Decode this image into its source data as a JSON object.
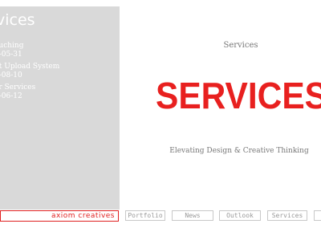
{
  "sidebar": {
    "title": "vices",
    "news": [
      {
        "title": "ouching",
        "date": "5-05-31"
      },
      {
        "title": "nt Upload System",
        "date": "5-08-10"
      },
      {
        "title": "er Services",
        "date": "5-06-12"
      }
    ]
  },
  "main": {
    "heading": "Services",
    "hero_text": "SERVICES",
    "hero_color": "#e8201f",
    "tagline": "Elevating Design & Creative Thinking"
  },
  "footer": {
    "brand": "axiom creatives",
    "brand_color": "#e02020",
    "nav": [
      "Portfolio",
      "News",
      "Outlook",
      "Services"
    ]
  }
}
